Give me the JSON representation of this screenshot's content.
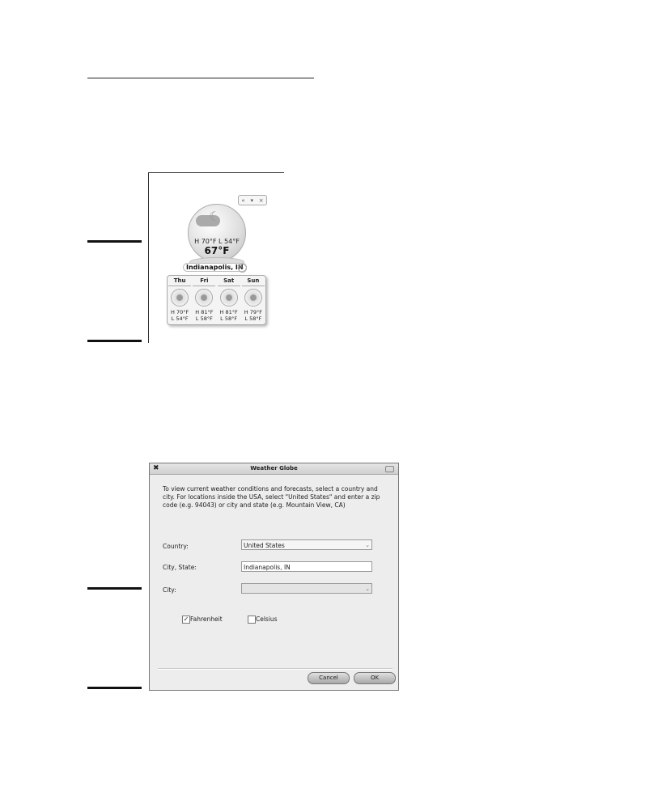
{
  "widget": {
    "controls": [
      "«",
      "▾",
      "×"
    ],
    "hi_lo": "H 70°F L 54°F",
    "current_temp": "67°F",
    "location": "Indianapolis, IN",
    "forecast": [
      {
        "day": "Thu",
        "high": "H 70°F",
        "low": "L 54°F"
      },
      {
        "day": "Fri",
        "high": "H 81°F",
        "low": "L 58°F"
      },
      {
        "day": "Sat",
        "high": "H 81°F",
        "low": "L 58°F"
      },
      {
        "day": "Sun",
        "high": "H 79°F",
        "low": "L 58°F"
      }
    ]
  },
  "dialog": {
    "title": "Weather Globe",
    "intro": "To view current weather conditions and forecasts, select a country and city.  For locations inside the USA, select \"United States\" and enter a zip code (e.g. 94043) or city and state (e.g. Mountain View, CA)",
    "country_label": "Country:",
    "country_value": "United States",
    "city_state_label": "City, State:",
    "city_state_value": "Indianapolis, IN",
    "city_label": "City:",
    "city_value": "",
    "fahrenheit_label": "Fahrenheit",
    "fahrenheit_checked": true,
    "celsius_label": "Celsius",
    "celsius_checked": false,
    "cancel_label": "Cancel",
    "ok_label": "OK"
  }
}
